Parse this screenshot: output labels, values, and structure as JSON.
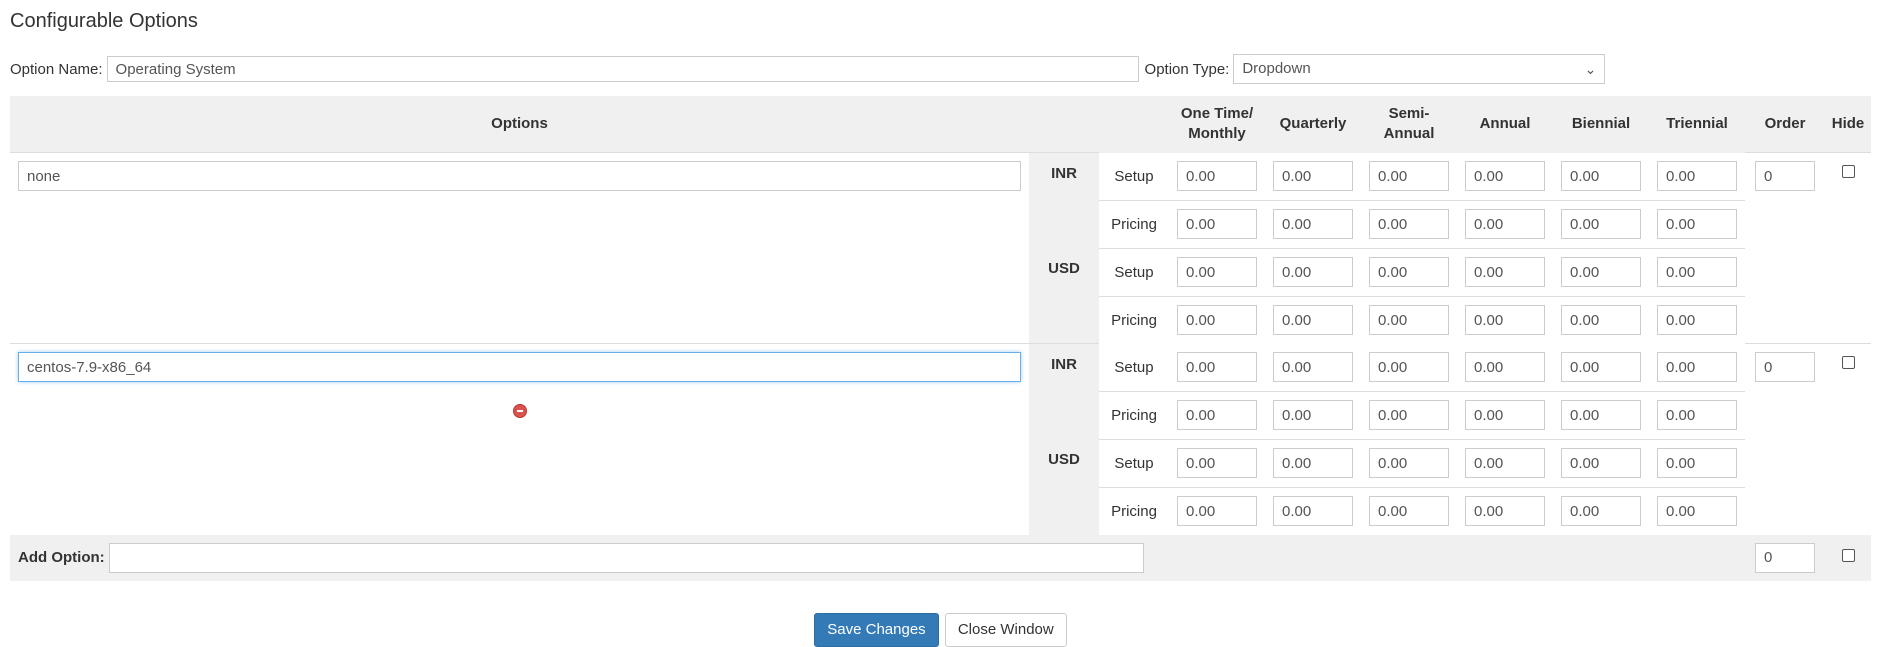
{
  "page": {
    "title": "Configurable Options",
    "option_name_label": "Option Name:",
    "option_name_value": "Operating System",
    "option_type_label": "Option Type:",
    "option_type_value": "Dropdown"
  },
  "table": {
    "header": {
      "options": "Options",
      "one_time_line1": "One Time/",
      "one_time_line2": "Monthly",
      "quarterly": "Quarterly",
      "semi_line1": "Semi-",
      "semi_line2": "Annual",
      "annual": "Annual",
      "biennial": "Biennial",
      "triennial": "Triennial",
      "order": "Order",
      "hide": "Hide"
    },
    "row_labels": {
      "setup": "Setup",
      "pricing": "Pricing"
    },
    "options": [
      {
        "name": "none",
        "order": "0",
        "currencies": [
          {
            "code": "INR",
            "setup": [
              "0.00",
              "0.00",
              "0.00",
              "0.00",
              "0.00",
              "0.00"
            ],
            "pricing": [
              "0.00",
              "0.00",
              "0.00",
              "0.00",
              "0.00",
              "0.00"
            ]
          },
          {
            "code": "USD",
            "setup": [
              "0.00",
              "0.00",
              "0.00",
              "0.00",
              "0.00",
              "0.00"
            ],
            "pricing": [
              "0.00",
              "0.00",
              "0.00",
              "0.00",
              "0.00",
              "0.00"
            ]
          }
        ]
      },
      {
        "name": "centos-7.9-x86_64",
        "order": "0",
        "currencies": [
          {
            "code": "INR",
            "setup": [
              "0.00",
              "0.00",
              "0.00",
              "0.00",
              "0.00",
              "0.00"
            ],
            "pricing": [
              "0.00",
              "0.00",
              "0.00",
              "0.00",
              "0.00",
              "0.00"
            ]
          },
          {
            "code": "USD",
            "setup": [
              "0.00",
              "0.00",
              "0.00",
              "0.00",
              "0.00",
              "0.00"
            ],
            "pricing": [
              "0.00",
              "0.00",
              "0.00",
              "0.00",
              "0.00",
              "0.00"
            ]
          }
        ]
      }
    ],
    "add_option_label": "Add Option:",
    "add_option_value": "",
    "add_order": "0"
  },
  "buttons": {
    "save": "Save Changes",
    "close": "Close Window"
  },
  "colors": {
    "primary": "#337ab7",
    "header_bg": "#f0f0f0",
    "remove_icon": "#d9534f"
  }
}
